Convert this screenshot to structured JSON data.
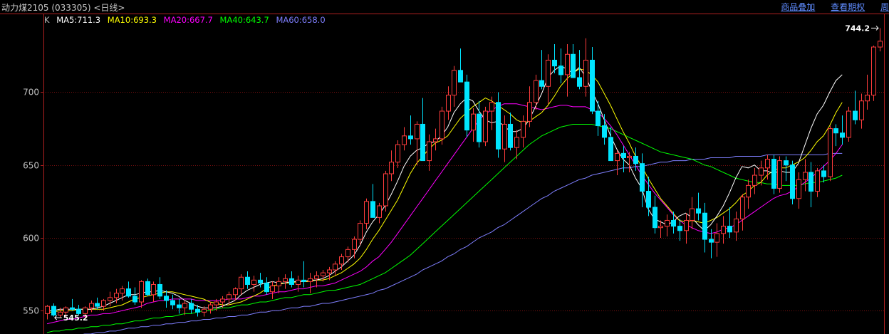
{
  "header": {
    "title": "动力煤2105 (033305) <日线>",
    "links": [
      "商品叠加",
      "查看期权",
      "周"
    ]
  },
  "legend": {
    "prefix": "K",
    "items": [
      {
        "label": "MA5:711.3",
        "color": "#ffffff"
      },
      {
        "label": "MA10:693.3",
        "color": "#ffff00"
      },
      {
        "label": "MA20:667.7",
        "color": "#ff00ff"
      },
      {
        "label": "MA40:643.7",
        "color": "#00ff00"
      },
      {
        "label": "MA60:658.0",
        "color": "#7f7fff"
      }
    ]
  },
  "chart_data": {
    "type": "candlestick",
    "y_ticks": [
      550,
      600,
      650,
      700
    ],
    "ylim": [
      534,
      754
    ],
    "annotations": {
      "high": "744.2",
      "low": "545.2"
    },
    "colors": {
      "up": "#ff3c3c",
      "down": "#00e5ff",
      "grid": "#7a1010",
      "axis": "#b02020"
    },
    "candles": [
      [
        548,
        554,
        544,
        553
      ],
      [
        553,
        555,
        546,
        547
      ],
      [
        547,
        552,
        545,
        549
      ],
      [
        549,
        553,
        546,
        552
      ],
      [
        552,
        558,
        550,
        551
      ],
      [
        551,
        554,
        547,
        548
      ],
      [
        548,
        553,
        545,
        552
      ],
      [
        552,
        557,
        549,
        555
      ],
      [
        555,
        559,
        551,
        553
      ],
      [
        553,
        558,
        550,
        557
      ],
      [
        557,
        563,
        553,
        559
      ],
      [
        559,
        565,
        555,
        562
      ],
      [
        562,
        567,
        557,
        565
      ],
      [
        565,
        570,
        559,
        560
      ],
      [
        560,
        566,
        554,
        556
      ],
      [
        556,
        571,
        552,
        570
      ],
      [
        570,
        572,
        560,
        561
      ],
      [
        561,
        570,
        556,
        568
      ],
      [
        568,
        573,
        558,
        560
      ],
      [
        560,
        564,
        552,
        557
      ],
      [
        557,
        561,
        551,
        554
      ],
      [
        554,
        558,
        548,
        552
      ],
      [
        552,
        557,
        547,
        555
      ],
      [
        555,
        558,
        548,
        551
      ],
      [
        551,
        554,
        546,
        549
      ],
      [
        549,
        553,
        546,
        551
      ],
      [
        551,
        556,
        548,
        554
      ],
      [
        554,
        558,
        550,
        556
      ],
      [
        556,
        560,
        552,
        558
      ],
      [
        558,
        563,
        554,
        561
      ],
      [
        561,
        566,
        557,
        565
      ],
      [
        565,
        575,
        561,
        573
      ],
      [
        573,
        577,
        565,
        568
      ],
      [
        568,
        574,
        563,
        571
      ],
      [
        571,
        576,
        566,
        569
      ],
      [
        569,
        573,
        561,
        563
      ],
      [
        563,
        570,
        558,
        567
      ],
      [
        567,
        573,
        562,
        570
      ],
      [
        570,
        575,
        565,
        572
      ],
      [
        572,
        577,
        566,
        568
      ],
      [
        568,
        574,
        563,
        571
      ],
      [
        571,
        584,
        566,
        570
      ],
      [
        570,
        576,
        562,
        572
      ],
      [
        572,
        577,
        566,
        574
      ],
      [
        574,
        578,
        570,
        576
      ],
      [
        576,
        580,
        571,
        578
      ],
      [
        578,
        584,
        574,
        582
      ],
      [
        582,
        589,
        578,
        587
      ],
      [
        587,
        594,
        583,
        592
      ],
      [
        592,
        601,
        586,
        599
      ],
      [
        599,
        612,
        595,
        610
      ],
      [
        610,
        627,
        606,
        625
      ],
      [
        625,
        637,
        618,
        614
      ],
      [
        614,
        624,
        610,
        622
      ],
      [
        622,
        646,
        618,
        644
      ],
      [
        644,
        660,
        639,
        652
      ],
      [
        652,
        667,
        648,
        664
      ],
      [
        664,
        676,
        660,
        670
      ],
      [
        670,
        684,
        664,
        668
      ],
      [
        668,
        680,
        650,
        678
      ],
      [
        678,
        696,
        667,
        653
      ],
      [
        653,
        671,
        646,
        666
      ],
      [
        666,
        675,
        660,
        668
      ],
      [
        668,
        690,
        664,
        687
      ],
      [
        687,
        704,
        681,
        698
      ],
      [
        698,
        718,
        690,
        715
      ],
      [
        715,
        730,
        708,
        707
      ],
      [
        707,
        712,
        669,
        674
      ],
      [
        674,
        689,
        666,
        685
      ],
      [
        685,
        694,
        662,
        666
      ],
      [
        666,
        690,
        663,
        687
      ],
      [
        687,
        697,
        674,
        693
      ],
      [
        693,
        700,
        655,
        661
      ],
      [
        661,
        684,
        652,
        678
      ],
      [
        678,
        686,
        660,
        662
      ],
      [
        662,
        674,
        654,
        669
      ],
      [
        669,
        684,
        662,
        680
      ],
      [
        680,
        704,
        676,
        693
      ],
      [
        693,
        712,
        688,
        708
      ],
      [
        708,
        729,
        702,
        704
      ],
      [
        704,
        726,
        692,
        722
      ],
      [
        722,
        733,
        713,
        718
      ],
      [
        718,
        730,
        706,
        712
      ],
      [
        712,
        733,
        697,
        726
      ],
      [
        726,
        733,
        712,
        710
      ],
      [
        710,
        729,
        702,
        704
      ],
      [
        704,
        737,
        697,
        722
      ],
      [
        722,
        731,
        685,
        687
      ],
      [
        687,
        694,
        670,
        677
      ],
      [
        677,
        685,
        664,
        669
      ],
      [
        669,
        676,
        653,
        653
      ],
      [
        653,
        660,
        643,
        658
      ],
      [
        658,
        663,
        645,
        655
      ],
      [
        655,
        659,
        645,
        656
      ],
      [
        656,
        662,
        646,
        651
      ],
      [
        651,
        658,
        621,
        632
      ],
      [
        632,
        642,
        615,
        621
      ],
      [
        621,
        629,
        603,
        607
      ],
      [
        607,
        612,
        600,
        608
      ],
      [
        608,
        616,
        601,
        612
      ],
      [
        612,
        618,
        603,
        608
      ],
      [
        608,
        613,
        598,
        605
      ],
      [
        605,
        617,
        596,
        612
      ],
      [
        612,
        628,
        606,
        620
      ],
      [
        620,
        631,
        612,
        617
      ],
      [
        617,
        624,
        590,
        599
      ],
      [
        599,
        606,
        586,
        597
      ],
      [
        597,
        610,
        587,
        603
      ],
      [
        603,
        615,
        596,
        608
      ],
      [
        608,
        621,
        600,
        604
      ],
      [
        604,
        618,
        598,
        613
      ],
      [
        613,
        630,
        605,
        628
      ],
      [
        628,
        640,
        620,
        636
      ],
      [
        636,
        648,
        630,
        643
      ],
      [
        643,
        653,
        636,
        648
      ],
      [
        648,
        657,
        640,
        654
      ],
      [
        654,
        657,
        630,
        634
      ],
      [
        634,
        656,
        631,
        653
      ],
      [
        653,
        656,
        639,
        650
      ],
      [
        650,
        653,
        623,
        627
      ],
      [
        627,
        645,
        620,
        640
      ],
      [
        640,
        654,
        632,
        645
      ],
      [
        645,
        652,
        621,
        632
      ],
      [
        632,
        648,
        628,
        646
      ],
      [
        646,
        650,
        638,
        642
      ],
      [
        642,
        677,
        639,
        675
      ],
      [
        675,
        678,
        663,
        672
      ],
      [
        672,
        684,
        664,
        669
      ],
      [
        669,
        690,
        666,
        687
      ],
      [
        687,
        701,
        678,
        681
      ],
      [
        681,
        699,
        675,
        694
      ],
      [
        694,
        712,
        688,
        698
      ],
      [
        698,
        732,
        694,
        731
      ],
      [
        731,
        744,
        728,
        735
      ]
    ],
    "ma5": [
      550,
      550,
      551,
      551,
      551,
      551,
      551,
      551,
      552,
      553,
      555,
      557,
      559,
      561,
      561,
      562,
      563,
      563,
      564,
      563,
      562,
      560,
      557,
      555,
      553,
      552,
      552,
      552,
      553,
      555,
      557,
      561,
      564,
      566,
      568,
      569,
      570,
      569,
      569,
      570,
      570,
      570,
      571,
      571,
      572,
      574,
      577,
      580,
      584,
      588,
      595,
      604,
      611,
      616,
      622,
      630,
      639,
      649,
      656,
      660,
      662,
      665,
      666,
      670,
      676,
      686,
      692,
      696,
      694,
      687,
      681,
      679,
      680,
      677,
      673,
      673,
      675,
      681,
      690,
      699,
      710,
      715,
      718,
      716,
      713,
      717,
      711,
      701,
      692,
      681,
      670,
      661,
      654,
      650,
      641,
      634,
      620,
      613,
      611,
      609,
      611,
      615,
      617,
      614,
      609,
      605,
      609,
      615,
      622,
      631,
      641,
      649,
      648,
      650,
      646,
      646,
      644,
      646,
      645,
      645,
      651,
      663,
      675,
      685,
      691,
      700,
      708,
      712
    ],
    "ma10": [
      549,
      549,
      550,
      550,
      550,
      551,
      551,
      551,
      551,
      551,
      552,
      553,
      554,
      556,
      558,
      559,
      560,
      561,
      562,
      563,
      563,
      562,
      561,
      560,
      559,
      558,
      556,
      555,
      554,
      554,
      555,
      556,
      558,
      560,
      562,
      565,
      567,
      568,
      569,
      569,
      570,
      570,
      570,
      571,
      571,
      572,
      574,
      576,
      579,
      582,
      586,
      592,
      599,
      605,
      612,
      619,
      626,
      635,
      644,
      651,
      656,
      661,
      665,
      667,
      670,
      676,
      682,
      686,
      690,
      693,
      696,
      694,
      691,
      688,
      685,
      681,
      679,
      680,
      683,
      686,
      691,
      697,
      704,
      709,
      713,
      716,
      715,
      712,
      707,
      699,
      691,
      682,
      673,
      665,
      656,
      649,
      641,
      634,
      627,
      622,
      617,
      612,
      611,
      612,
      611,
      610,
      612,
      614,
      617,
      620,
      624,
      629,
      632,
      636,
      638,
      643,
      646,
      648,
      648,
      650,
      652,
      655,
      660,
      666,
      670,
      677,
      686,
      693
    ],
    "ma20": [
      541,
      542,
      543,
      544,
      544,
      545,
      546,
      547,
      547,
      548,
      548,
      549,
      550,
      551,
      552,
      553,
      555,
      556,
      557,
      557,
      558,
      558,
      558,
      558,
      557,
      557,
      557,
      557,
      557,
      558,
      558,
      558,
      559,
      560,
      560,
      561,
      562,
      563,
      563,
      564,
      565,
      565,
      566,
      567,
      567,
      568,
      569,
      571,
      573,
      575,
      577,
      580,
      584,
      587,
      592,
      597,
      603,
      609,
      615,
      621,
      627,
      633,
      639,
      645,
      651,
      657,
      663,
      669,
      675,
      681,
      685,
      688,
      690,
      692,
      692,
      692,
      691,
      690,
      689,
      688,
      689,
      690,
      691,
      691,
      690,
      690,
      690,
      688,
      686,
      682,
      677,
      671,
      664,
      657,
      650,
      643,
      637,
      631,
      626,
      621,
      616,
      612,
      609,
      607,
      605,
      604,
      603,
      604,
      606,
      607,
      609,
      612,
      615,
      618,
      621,
      624,
      627,
      629,
      630,
      632,
      635,
      638,
      641,
      645,
      649,
      653,
      658,
      664
    ],
    "ma40": [
      535,
      536,
      536,
      537,
      537,
      538,
      538,
      539,
      539,
      540,
      540,
      541,
      541,
      542,
      543,
      543,
      544,
      545,
      545,
      546,
      546,
      547,
      548,
      548,
      549,
      550,
      550,
      551,
      552,
      552,
      553,
      554,
      554,
      555,
      556,
      556,
      557,
      558,
      559,
      559,
      560,
      561,
      561,
      562,
      563,
      564,
      564,
      565,
      566,
      567,
      568,
      570,
      572,
      574,
      576,
      579,
      582,
      585,
      588,
      592,
      596,
      600,
      604,
      608,
      612,
      616,
      620,
      624,
      628,
      632,
      636,
      640,
      644,
      648,
      652,
      656,
      660,
      664,
      667,
      670,
      672,
      674,
      676,
      677,
      678,
      678,
      678,
      678,
      677,
      676,
      675,
      673,
      671,
      669,
      667,
      665,
      663,
      661,
      659,
      658,
      657,
      656,
      655,
      654,
      652,
      650,
      649,
      647,
      645,
      643,
      641,
      640,
      639,
      638,
      638,
      637,
      637,
      636,
      636,
      636,
      636,
      637,
      638,
      638,
      639,
      640,
      641,
      643
    ],
    "ma60": [
      531,
      532,
      532,
      532,
      533,
      533,
      534,
      534,
      535,
      535,
      536,
      536,
      537,
      538,
      538,
      539,
      539,
      540,
      540,
      541,
      541,
      542,
      542,
      543,
      543,
      544,
      544,
      545,
      545,
      546,
      546,
      547,
      547,
      548,
      549,
      549,
      550,
      550,
      551,
      552,
      552,
      553,
      553,
      554,
      555,
      555,
      556,
      557,
      558,
      559,
      560,
      561,
      562,
      564,
      565,
      567,
      569,
      571,
      573,
      575,
      578,
      580,
      582,
      584,
      587,
      589,
      592,
      594,
      597,
      600,
      602,
      604,
      607,
      609,
      612,
      615,
      618,
      621,
      624,
      627,
      629,
      632,
      634,
      636,
      638,
      640,
      641,
      643,
      644,
      645,
      646,
      647,
      648,
      648,
      649,
      649,
      650,
      651,
      652,
      652,
      653,
      653,
      653,
      654,
      654,
      654,
      655,
      655,
      655,
      655,
      656,
      656,
      656,
      656,
      656,
      657,
      657,
      657,
      657,
      657,
      657,
      657,
      657,
      657,
      657,
      658,
      658,
      658
    ]
  }
}
